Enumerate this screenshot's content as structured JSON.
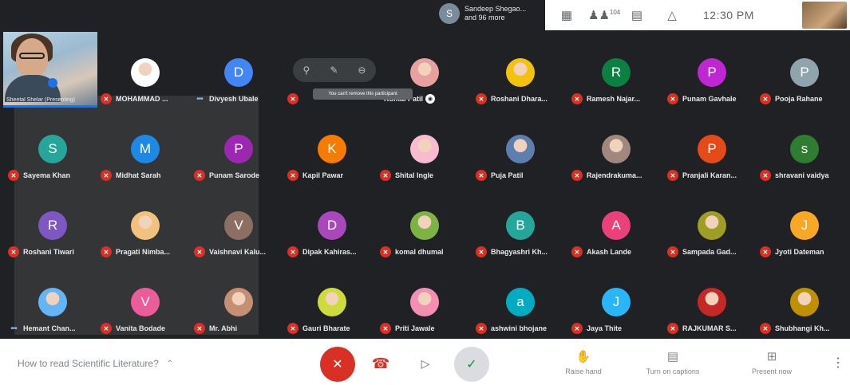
{
  "topbar": {
    "presenter_initial": "S",
    "presenter_line1": "Sandeep Shegao...",
    "presenter_line2": "and 96 more",
    "people_count": "104",
    "clock": "12:30 PM"
  },
  "self_view": {
    "name": "Sheetal Shelar (Presenting)"
  },
  "hover_tooltip": "You can't remove this participant",
  "tiles": [
    {
      "name": "MOHAMMAD ...",
      "initial": "",
      "color": "#ffffff",
      "photo": true,
      "muted": true,
      "col": 1,
      "row": 0
    },
    {
      "name": "Divyesh Ubale",
      "initial": "D",
      "color": "#4285f4",
      "photo": false,
      "muted": false,
      "col": 2,
      "row": 0
    },
    {
      "name": "",
      "initial": "",
      "color": "",
      "photo": false,
      "muted": true,
      "col": 3,
      "row": 0,
      "hover": true
    },
    {
      "name": "Komal Patil",
      "initial": "",
      "color": "#e8a0a0",
      "photo": true,
      "muted": false,
      "col": 4,
      "row": 0,
      "pin": true
    },
    {
      "name": "Roshani Dhara...",
      "initial": "",
      "color": "#f4c20d",
      "photo": true,
      "muted": true,
      "col": 5,
      "row": 0
    },
    {
      "name": "Ramesh Najar...",
      "initial": "R",
      "color": "#0b8043",
      "photo": false,
      "muted": true,
      "col": 6,
      "row": 0
    },
    {
      "name": "Punam Gavhale",
      "initial": "P",
      "color": "#c026d3",
      "photo": false,
      "muted": true,
      "col": 7,
      "row": 0
    },
    {
      "name": "Pooja Rahane",
      "initial": "P",
      "color": "#90a4ae",
      "photo": false,
      "muted": true,
      "col": 8,
      "row": 0
    },
    {
      "name": "Sayema Khan",
      "initial": "S",
      "color": "#26a69a",
      "photo": false,
      "muted": true,
      "col": 0,
      "row": 1
    },
    {
      "name": "Midhat Sarah",
      "initial": "M",
      "color": "#1e88e5",
      "photo": false,
      "muted": true,
      "col": 1,
      "row": 1
    },
    {
      "name": "Punam Sarode",
      "initial": "P",
      "color": "#9c27b0",
      "photo": false,
      "muted": true,
      "col": 2,
      "row": 1
    },
    {
      "name": "Kapil Pawar",
      "initial": "K",
      "color": "#f57c00",
      "photo": false,
      "muted": true,
      "col": 3,
      "row": 1
    },
    {
      "name": "Shital Ingle",
      "initial": "",
      "color": "#f8bbd0",
      "photo": true,
      "muted": true,
      "col": 4,
      "row": 1
    },
    {
      "name": "Puja Patil",
      "initial": "",
      "color": "#5c7fb0",
      "photo": true,
      "muted": true,
      "col": 5,
      "row": 1
    },
    {
      "name": "Rajendrakuma...",
      "initial": "",
      "color": "#a1887f",
      "photo": true,
      "muted": true,
      "col": 6,
      "row": 1
    },
    {
      "name": "Pranjali Karan...",
      "initial": "P",
      "color": "#e64a19",
      "photo": false,
      "muted": true,
      "col": 7,
      "row": 1
    },
    {
      "name": "shravani vaidya",
      "initial": "s",
      "color": "#2e7d32",
      "photo": false,
      "muted": true,
      "col": 8,
      "row": 1
    },
    {
      "name": "Roshani Tiwari",
      "initial": "R",
      "color": "#7e57c2",
      "photo": false,
      "muted": true,
      "col": 0,
      "row": 2
    },
    {
      "name": "Pragati Nimba...",
      "initial": "",
      "color": "#f0c27b",
      "photo": true,
      "muted": true,
      "col": 1,
      "row": 2
    },
    {
      "name": "Vaishnavi Kalu...",
      "initial": "V",
      "color": "#8d6e63",
      "photo": false,
      "muted": true,
      "col": 2,
      "row": 2
    },
    {
      "name": "Dipak Kahiras...",
      "initial": "D",
      "color": "#ab47bc",
      "photo": false,
      "muted": true,
      "col": 3,
      "row": 2
    },
    {
      "name": "komal dhumal",
      "initial": "",
      "color": "#7cb342",
      "photo": true,
      "muted": true,
      "col": 4,
      "row": 2
    },
    {
      "name": "Bhagyashri Kh...",
      "initial": "B",
      "color": "#26a69a",
      "photo": false,
      "muted": true,
      "col": 5,
      "row": 2
    },
    {
      "name": "Akash Lande",
      "initial": "A",
      "color": "#ec407a",
      "photo": false,
      "muted": true,
      "col": 6,
      "row": 2
    },
    {
      "name": "Sampada Gad...",
      "initial": "",
      "color": "#9e9d24",
      "photo": true,
      "muted": true,
      "col": 7,
      "row": 2
    },
    {
      "name": "Jyoti Dateman",
      "initial": "J",
      "color": "#f9a825",
      "photo": false,
      "muted": true,
      "col": 8,
      "row": 2
    },
    {
      "name": "Hemant Chan...",
      "initial": "",
      "color": "#64b5f6",
      "photo": true,
      "muted": false,
      "col": 0,
      "row": 3
    },
    {
      "name": "Vanita Bodade",
      "initial": "V",
      "color": "#ec5c9a",
      "photo": false,
      "muted": true,
      "col": 1,
      "row": 3
    },
    {
      "name": "Mr. Abhi",
      "initial": "",
      "color": "#c58f74",
      "photo": true,
      "muted": true,
      "col": 2,
      "row": 3
    },
    {
      "name": "Gauri Bharate",
      "initial": "",
      "color": "#cddc39",
      "photo": true,
      "muted": true,
      "col": 3,
      "row": 3
    },
    {
      "name": "Priti Jawale",
      "initial": "",
      "color": "#f48fb1",
      "photo": true,
      "muted": true,
      "col": 4,
      "row": 3
    },
    {
      "name": "ashwini bhojane",
      "initial": "a",
      "color": "#00acc1",
      "photo": false,
      "muted": true,
      "col": 5,
      "row": 3
    },
    {
      "name": "Jaya Thite",
      "initial": "J",
      "color": "#29b6f6",
      "photo": false,
      "muted": true,
      "col": 6,
      "row": 3
    },
    {
      "name": "RAJKUMAR S...",
      "initial": "",
      "color": "#c62828",
      "photo": true,
      "muted": true,
      "col": 7,
      "row": 3
    },
    {
      "name": "Shubhangi Kh...",
      "initial": "",
      "color": "#bf9000",
      "photo": true,
      "muted": true,
      "col": 8,
      "row": 3
    }
  ],
  "bottombar": {
    "meeting_title": "How to read Scientific Literature?",
    "raise_hand": "Raise hand",
    "captions": "Turn on captions",
    "present": "Present now"
  },
  "colors": {
    "background": "#202124",
    "mute": "#d93025",
    "accent": "#1a73e8"
  }
}
